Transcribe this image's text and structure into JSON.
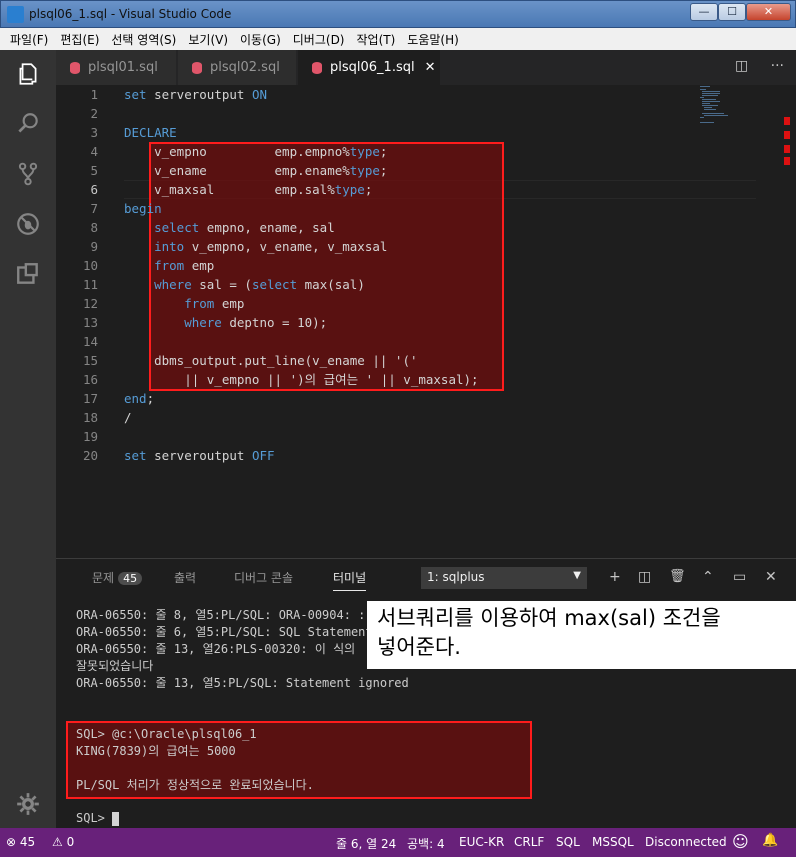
{
  "window": {
    "title": "plsql06_1.sql - Visual Studio Code",
    "min": "—",
    "max": "☐",
    "close": "✕"
  },
  "menu": [
    "파일(F)",
    "편집(E)",
    "선택 영역(S)",
    "보기(V)",
    "이동(G)",
    "디버그(D)",
    "작업(T)",
    "도움말(H)"
  ],
  "activity": [
    "files-icon",
    "search-icon",
    "source-control-icon",
    "debug-icon",
    "extensions-icon",
    "settings-gear-icon"
  ],
  "tabs": [
    {
      "label": "plsql01.sql",
      "active": false
    },
    {
      "label": "plsql02.sql",
      "active": false
    },
    {
      "label": "plsql06_1.sql",
      "active": true,
      "close": "✕"
    }
  ],
  "tab_actions": {
    "split": "◫",
    "more": "···"
  },
  "editor": {
    "lines": [
      {
        "n": "1",
        "tokens": [
          [
            "kw",
            "set "
          ],
          [
            "tx",
            "serveroutput "
          ],
          [
            "kw",
            "ON"
          ]
        ]
      },
      {
        "n": "2",
        "tokens": []
      },
      {
        "n": "3",
        "tokens": [
          [
            "kw",
            "DECLARE"
          ]
        ]
      },
      {
        "n": "4",
        "tokens": [
          [
            "tx",
            "    v_empno         emp.empno%"
          ],
          [
            "kw",
            "type"
          ],
          [
            "tx",
            ";"
          ]
        ]
      },
      {
        "n": "5",
        "tokens": [
          [
            "tx",
            "    v_ename         emp.ename%"
          ],
          [
            "kw",
            "type"
          ],
          [
            "tx",
            ";"
          ]
        ]
      },
      {
        "n": "6",
        "tokens": [
          [
            "tx",
            "    v_maxsal        emp.sal%"
          ],
          [
            "kw",
            "type"
          ],
          [
            "tx",
            ";"
          ]
        ]
      },
      {
        "n": "7",
        "tokens": [
          [
            "kw",
            "begin"
          ]
        ]
      },
      {
        "n": "8",
        "tokens": [
          [
            "kw",
            "    select "
          ],
          [
            "tx",
            "empno, ename, sal"
          ]
        ]
      },
      {
        "n": "9",
        "tokens": [
          [
            "kw",
            "    into "
          ],
          [
            "tx",
            "v_empno, v_ename, v_maxsal"
          ]
        ]
      },
      {
        "n": "10",
        "tokens": [
          [
            "kw",
            "    from "
          ],
          [
            "tx",
            "emp"
          ]
        ]
      },
      {
        "n": "11",
        "tokens": [
          [
            "kw",
            "    where "
          ],
          [
            "tx",
            "sal = ("
          ],
          [
            "kw",
            "select "
          ],
          [
            "tx",
            "max(sal)"
          ]
        ]
      },
      {
        "n": "12",
        "tokens": [
          [
            "kw",
            "        from "
          ],
          [
            "tx",
            "emp"
          ]
        ]
      },
      {
        "n": "13",
        "tokens": [
          [
            "kw",
            "        where "
          ],
          [
            "tx",
            "deptno = 10);"
          ]
        ]
      },
      {
        "n": "14",
        "tokens": []
      },
      {
        "n": "15",
        "tokens": [
          [
            "tx",
            "    dbms_output.put_line(v_ename || '('"
          ]
        ]
      },
      {
        "n": "16",
        "tokens": [
          [
            "tx",
            "        || v_empno || ')의 급여는 ' || v_maxsal);"
          ]
        ]
      },
      {
        "n": "17",
        "tokens": [
          [
            "kw",
            "end"
          ],
          [
            "tx",
            ";"
          ]
        ]
      },
      {
        "n": "18",
        "tokens": [
          [
            "tx",
            "/"
          ]
        ]
      },
      {
        "n": "19",
        "tokens": []
      },
      {
        "n": "20",
        "tokens": [
          [
            "kw",
            "set "
          ],
          [
            "tx",
            "serveroutput "
          ],
          [
            "kw",
            "OFF"
          ]
        ]
      }
    ]
  },
  "panel": {
    "tabs": [
      {
        "label": "문제",
        "badge": "45"
      },
      {
        "label": "출력"
      },
      {
        "label": "디버그 콘솔"
      },
      {
        "label": "터미널",
        "active": true
      }
    ],
    "terminal_select": "1: sqlplus",
    "select_arrow": "▼",
    "icons": {
      "add": "+",
      "split": "◫",
      "trash": "🗑",
      "up": "⌃",
      "maximize": "▭",
      "close": "✕"
    },
    "terminal_lines": [
      "ORA-06550: 줄 8, 열5:PL/SQL: ORA-00904: :",
      "ORA-06550: 줄 6, 열5:PL/SQL: SQL Statement",
      "ORA-06550: 줄 13, 열26:PLS-00320: 이 식의",
      "잘못되었습니다",
      "ORA-06550: 줄 13, 열5:PL/SQL: Statement ignored"
    ],
    "result_lines": [
      "SQL> @c:\\Oracle\\plsql06_1",
      "KING(7839)의 급여는 5000",
      "",
      "PL/SQL 처리가 정상적으로 완료되었습니다."
    ],
    "prompt": "SQL> "
  },
  "callout": {
    "line1": "서브쿼리를 이용하여 max(sal) 조건을",
    "line2": "넣어준다."
  },
  "status": {
    "errors": "⊗ 45",
    "warnings": "⚠ 0",
    "position": "줄 6, 열 24",
    "spaces": "공백: 4",
    "encoding": "EUC-KR",
    "eol": "CRLF",
    "language": "SQL",
    "db": "MSSQL",
    "connection": "Disconnected",
    "smiley": "☺",
    "bell": "🔔"
  }
}
